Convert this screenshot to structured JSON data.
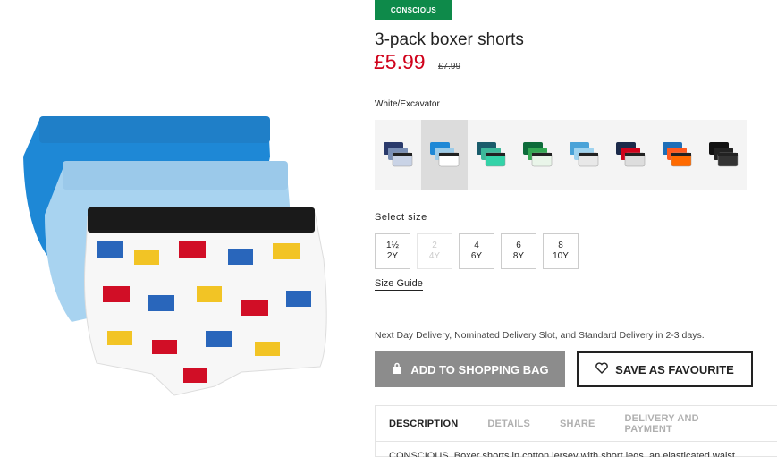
{
  "badge": "CONSCIOUS",
  "product": {
    "title": "3-pack boxer shorts",
    "price": "£5.99",
    "old_price": "£7.99"
  },
  "color": {
    "selected_label": "White/Excavator",
    "swatches": [
      {
        "icon": "dark-blue-striped-pack",
        "colors": [
          "#2a3a6b",
          "#7a8fb5",
          "#c9d3e6"
        ]
      },
      {
        "icon": "excavator-print-pack",
        "colors": [
          "#1e88d6",
          "#9ccbe8",
          "#ffffff"
        ]
      },
      {
        "icon": "turquoise-pack",
        "colors": [
          "#1a5c6b",
          "#3cb89a",
          "#33d3a8"
        ]
      },
      {
        "icon": "green-pack",
        "colors": [
          "#0d6b3a",
          "#34a853",
          "#e9f5e9"
        ]
      },
      {
        "icon": "light-blue-pack",
        "colors": [
          "#4aa3d8",
          "#9fd3ef",
          "#e8e8e8"
        ]
      },
      {
        "icon": "red-navy-pack",
        "colors": [
          "#1b2a4a",
          "#d0021b",
          "#dddddd"
        ]
      },
      {
        "icon": "orange-pack",
        "colors": [
          "#1e6fb8",
          "#ff5a1f",
          "#ff6a00"
        ]
      },
      {
        "icon": "black-pack",
        "colors": [
          "#111111",
          "#222222",
          "#333333"
        ]
      }
    ]
  },
  "size": {
    "label": "Select size",
    "options": [
      {
        "top": "1½",
        "bottom": "2Y",
        "available": true
      },
      {
        "top": "2",
        "bottom": "4Y",
        "available": false
      },
      {
        "top": "4",
        "bottom": "6Y",
        "available": true
      },
      {
        "top": "6",
        "bottom": "8Y",
        "available": true
      },
      {
        "top": "8",
        "bottom": "10Y",
        "available": true
      }
    ],
    "guide_label": "Size Guide"
  },
  "delivery_text": "Next Day Delivery, Nominated Delivery Slot, and Standard Delivery in 2-3 days.",
  "actions": {
    "add_to_bag": "ADD TO SHOPPING BAG",
    "favourite": "SAVE AS FAVOURITE"
  },
  "tabs": [
    "DESCRIPTION",
    "DETAILS",
    "SHARE",
    "DELIVERY AND PAYMENT"
  ],
  "description": "CONSCIOUS. Boxer shorts in cotton jersey with short legs, an elasticated waist",
  "colors": {
    "badge": "#0e8a4a",
    "price": "#d0021b",
    "button_grey": "#8c8c8c"
  }
}
